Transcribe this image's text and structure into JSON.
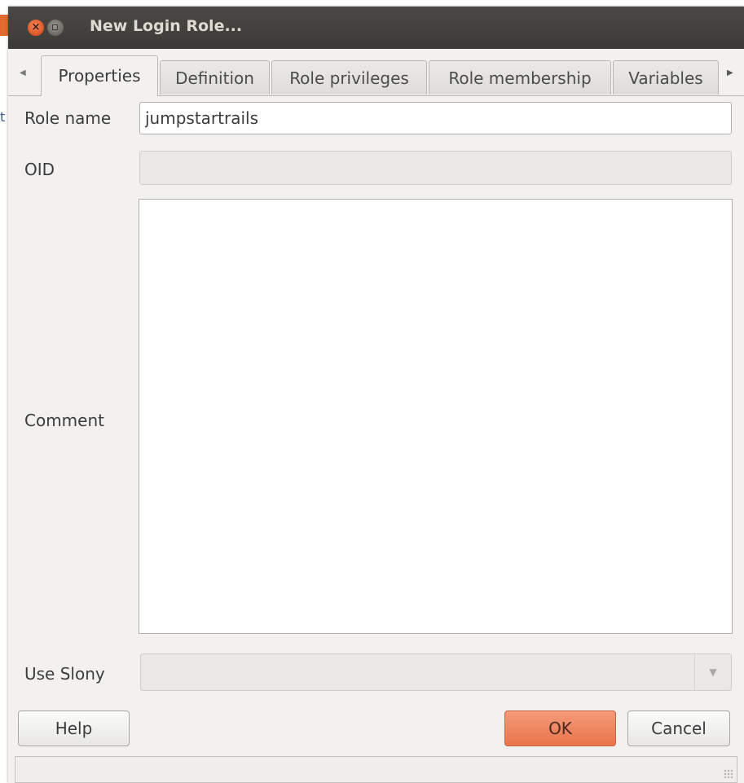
{
  "window": {
    "title": "New Login Role..."
  },
  "tabs": [
    {
      "label": "Properties",
      "active": true
    },
    {
      "label": "Definition",
      "active": false
    },
    {
      "label": "Role privileges",
      "active": false
    },
    {
      "label": "Role membership",
      "active": false
    },
    {
      "label": "Variables",
      "active": false
    }
  ],
  "form": {
    "role_name_label": "Role name",
    "role_name_value": "jumpstartrails",
    "oid_label": "OID",
    "oid_value": "",
    "comment_label": "Comment",
    "comment_value": "",
    "use_slony_label": "Use Slony",
    "use_slony_value": ""
  },
  "buttons": {
    "help": "Help",
    "ok": "OK",
    "cancel": "Cancel"
  },
  "colors": {
    "titlebar": "#3c3b37",
    "accent": "#e9744c",
    "background": "#f2f1f0"
  }
}
